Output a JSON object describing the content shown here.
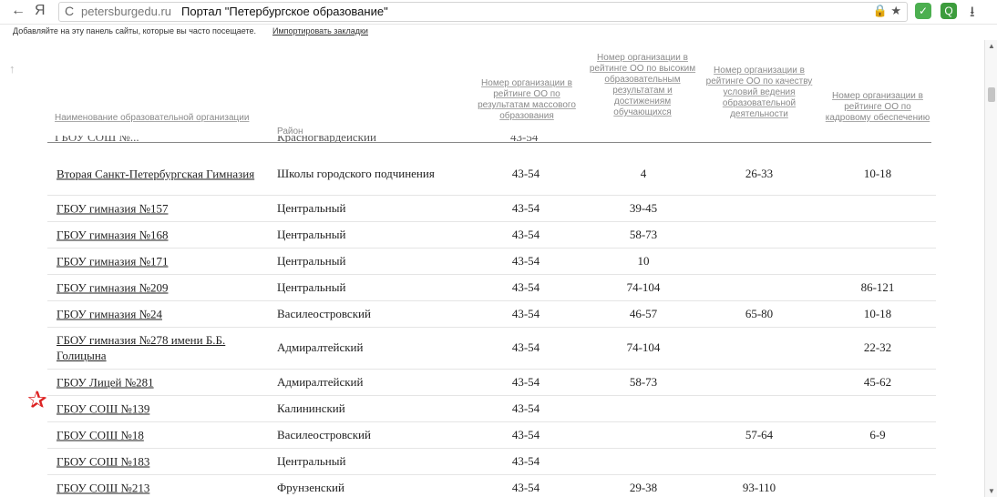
{
  "browser": {
    "back": "←",
    "yandex": "Я",
    "reload": "C",
    "domain": "petersburgedu.ru",
    "title": "Портал \"Петербургское образование\"",
    "icons": "🔒 ★",
    "download": "⭳"
  },
  "bookmarks": {
    "message": "Добавляйте на эту панель сайты, которые вы часто посещаете.",
    "import_link": "Импортировать закладки"
  },
  "table": {
    "headers": {
      "name": "Наименование образовательной организации",
      "district": "Район",
      "r1": "Номер организации в рейтинге ОО по результатам массового образования",
      "r2": "Номер организации в рейтинге ОО по высоким образовательным результатам и достижениям обучающихся",
      "r3": "Номер организации в рейтинге ОО по качеству условий ведения образовательной деятельности",
      "r4": "Номер организации в рейтинге ОО по кадровому обеспечению"
    },
    "partial_row": {
      "name": "ГБОУ СОШ №...",
      "district": "Красногвардейский",
      "r1": "43-54"
    },
    "rows": [
      {
        "name": "Вторая Санкт-Петербургская Гимназия",
        "district": "Школы городского подчинения",
        "r1": "43-54",
        "r2": "4",
        "r3": "26-33",
        "r4": "10-18"
      },
      {
        "name": "ГБОУ гимназия №157",
        "district": "Центральный",
        "r1": "43-54",
        "r2": "39-45",
        "r3": "",
        "r4": ""
      },
      {
        "name": "ГБОУ гимназия №168",
        "district": "Центральный",
        "r1": "43-54",
        "r2": "58-73",
        "r3": "",
        "r4": ""
      },
      {
        "name": "ГБОУ гимназия №171",
        "district": "Центральный",
        "r1": "43-54",
        "r2": "10",
        "r3": "",
        "r4": ""
      },
      {
        "name": "ГБОУ гимназия №209",
        "district": "Центральный",
        "r1": "43-54",
        "r2": "74-104",
        "r3": "",
        "r4": "86-121"
      },
      {
        "name": "ГБОУ гимназия №24",
        "district": "Василеостровский",
        "r1": "43-54",
        "r2": "46-57",
        "r3": "65-80",
        "r4": "10-18"
      },
      {
        "name": "ГБОУ гимназия №278 имени Б.Б. Голицына",
        "district": "Адмиралтейский",
        "r1": "43-54",
        "r2": "74-104",
        "r3": "",
        "r4": "22-32"
      },
      {
        "name": "ГБОУ Лицей №281",
        "district": "Адмиралтейский",
        "r1": "43-54",
        "r2": "58-73",
        "r3": "",
        "r4": "45-62"
      },
      {
        "name": "ГБОУ СОШ №139",
        "district": "Калининский",
        "r1": "43-54",
        "r2": "",
        "r3": "",
        "r4": ""
      },
      {
        "name": "ГБОУ СОШ №18",
        "district": "Василеостровский",
        "r1": "43-54",
        "r2": "",
        "r3": "57-64",
        "r4": "6-9"
      },
      {
        "name": "ГБОУ СОШ №183",
        "district": "Центральный",
        "r1": "43-54",
        "r2": "",
        "r3": "",
        "r4": ""
      },
      {
        "name": "ГБОУ СОШ №213",
        "district": "Фрунзенский",
        "r1": "43-54",
        "r2": "29-38",
        "r3": "93-110",
        "r4": ""
      }
    ]
  },
  "marker": {
    "icon": "star-icon",
    "color": "#d22222",
    "glyph": "✰"
  }
}
